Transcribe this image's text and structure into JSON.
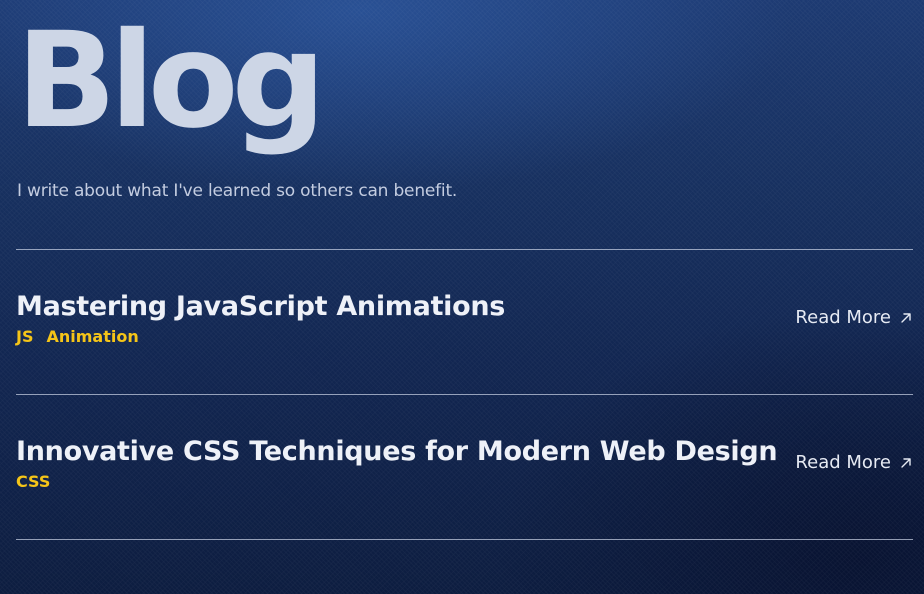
{
  "header": {
    "title": "Blog",
    "subtitle": "I write about what I've learned so others can benefit."
  },
  "posts": [
    {
      "title": "Mastering JavaScript Animations",
      "tags": [
        "JS",
        "Animation"
      ],
      "link_label": "Read More",
      "link_icon": "arrow-up-right-icon"
    },
    {
      "title": "Innovative CSS Techniques for Modern Web Design",
      "tags": [
        "CSS"
      ],
      "link_label": "Read More",
      "link_icon": "arrow-up-right-icon"
    }
  ],
  "colors": {
    "background": "#17305f",
    "tag": "#f5c518",
    "title": "#cdd6e6",
    "text": "#eef1f7",
    "divider": "#cdd6e8"
  }
}
